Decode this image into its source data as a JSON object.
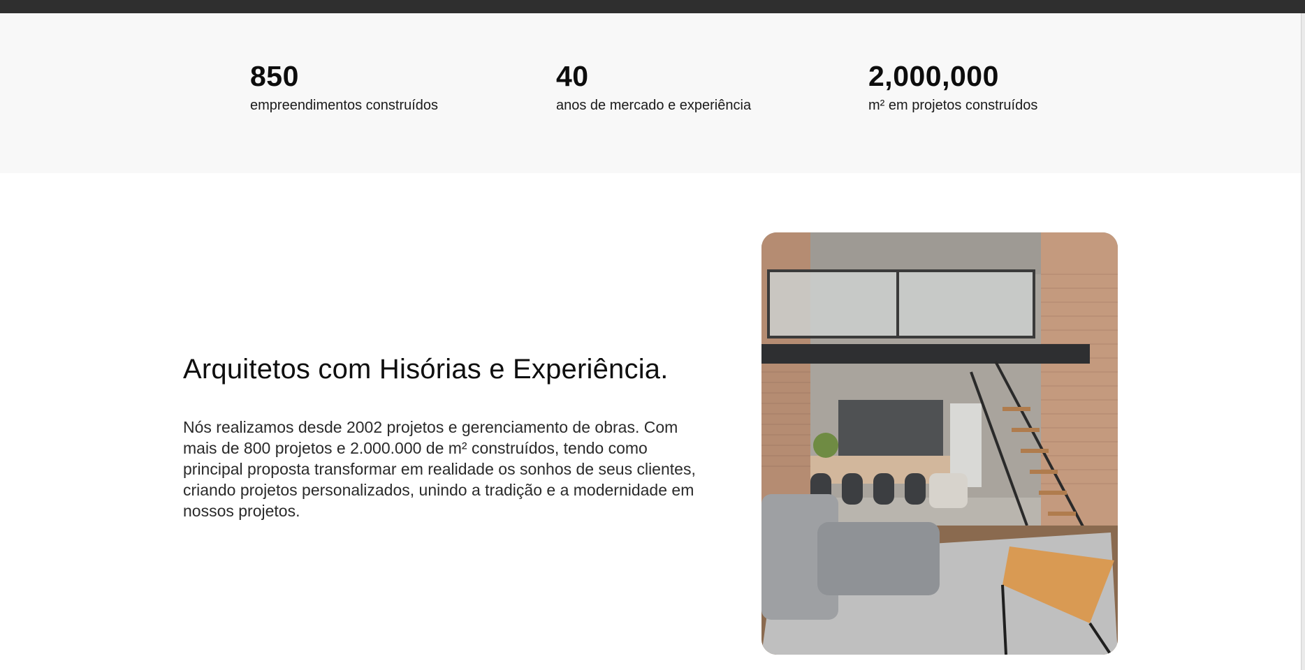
{
  "stats": [
    {
      "value": "850",
      "label": "empreendimentos construídos"
    },
    {
      "value": "40",
      "label": "anos de mercado e experiência"
    },
    {
      "value": "2,000,000",
      "label": "m² em projetos construídos"
    }
  ],
  "about": {
    "title": "Arquitetos com Hisórias e Experiência.",
    "text": "Nós realizamos desde 2002 projetos e gerenciamento de obras. Com mais de 800 projetos e 2.000.000 de m² construídos, tendo como principal proposta transformar em realidade os sonhos de seus clientes, criando projetos personalizados, unindo a tradição e a modernidade em nossos projetos."
  },
  "colors": {
    "topbar": "#2f2f2f",
    "stats_background": "#f8f8f8",
    "page_background": "#ffffff"
  }
}
